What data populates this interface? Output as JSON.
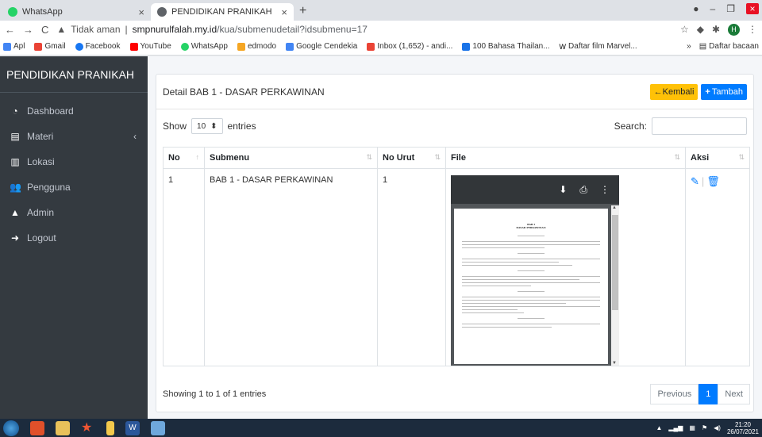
{
  "browser": {
    "tabs": [
      {
        "label": "WhatsApp",
        "active": false
      },
      {
        "label": "PENDIDIKAN PRANIKAH",
        "active": true
      }
    ],
    "new_tab": "+",
    "security": "Tidak aman",
    "url_host": "smpnurulfalah.my.id",
    "url_path": "/kua/submenudetail?idsubmenu=17",
    "bookmarks": [
      "Apl",
      "Gmail",
      "Facebook",
      "YouTube",
      "WhatsApp",
      "edmodo",
      "Google Cendekia",
      "Inbox (1,652) - andi...",
      "100 Bahasa Thailan...",
      "Daftar film Marvel..."
    ],
    "bookmarks_overflow": "»",
    "reading_list": "Daftar bacaan",
    "profile_initial": "H"
  },
  "sidebar": {
    "brand": "PENDIDIKAN PRANIKAH",
    "items": [
      {
        "label": "Dashboard",
        "icon": "tachometer-icon"
      },
      {
        "label": "Materi",
        "icon": "file-icon"
      },
      {
        "label": "Lokasi",
        "icon": "map-icon"
      },
      {
        "label": "Pengguna",
        "icon": "users-icon"
      },
      {
        "label": "Admin",
        "icon": "user-icon"
      },
      {
        "label": "Logout",
        "icon": "sign-out-icon"
      }
    ]
  },
  "card": {
    "title": "Detail BAB 1 - DASAR PERKAWINAN",
    "back_label": "Kembali",
    "add_label": "Tambah"
  },
  "controls": {
    "show": "Show",
    "page_size": "10",
    "entries": "entries",
    "search_label": "Search:",
    "search_value": ""
  },
  "table": {
    "columns": [
      "No",
      "Submenu",
      "No Urut",
      "File",
      "Aksi"
    ],
    "rows": [
      {
        "no": "1",
        "submenu": "BAB 1 - DASAR PERKAWINAN",
        "no_urut": "1"
      }
    ]
  },
  "pdf": {
    "heading1": "BAB I",
    "heading2": "DASAR PERKAWINAN"
  },
  "footer": {
    "info": "Showing 1 to 1 of 1 entries",
    "previous": "Previous",
    "page": "1",
    "next": "Next"
  },
  "taskbar": {
    "time": "21:20",
    "date": "26/07/2021"
  },
  "colors": {
    "sidebar": "#343a40",
    "primary": "#007bff",
    "warning": "#ffc107"
  }
}
